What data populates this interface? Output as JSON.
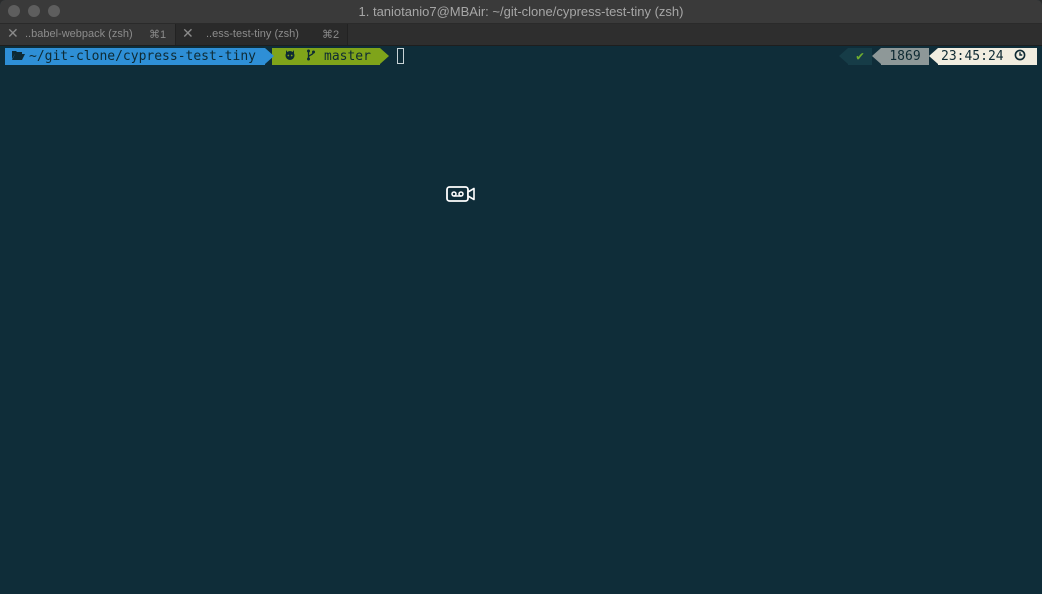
{
  "window": {
    "title": "1. taniotanio7@MBAir: ~/git-clone/cypress-test-tiny (zsh)"
  },
  "tabs": [
    {
      "label": "..babel-webpack (zsh)",
      "shortcut": "⌘1"
    },
    {
      "label": "..ess-test-tiny (zsh)",
      "shortcut": "⌘2"
    }
  ],
  "prompt": {
    "directory": "~/git-clone/cypress-test-tiny",
    "branch": "master",
    "status_icon": "✔",
    "history_number": "1869",
    "time": "23:45:24"
  },
  "colors": {
    "background": "#0f2d39",
    "dir_segment": "#2e8fd6",
    "git_segment": "#7fa41a",
    "status_check": "#6fae2f",
    "history_segment": "#8e9898",
    "time_segment": "#f1ede0"
  },
  "icons": {
    "folder": "folder-open-icon",
    "github": "github-icon",
    "branch": "git-branch-icon",
    "check": "check-icon",
    "clock": "clock-icon",
    "camera": "video-camera-icon"
  }
}
